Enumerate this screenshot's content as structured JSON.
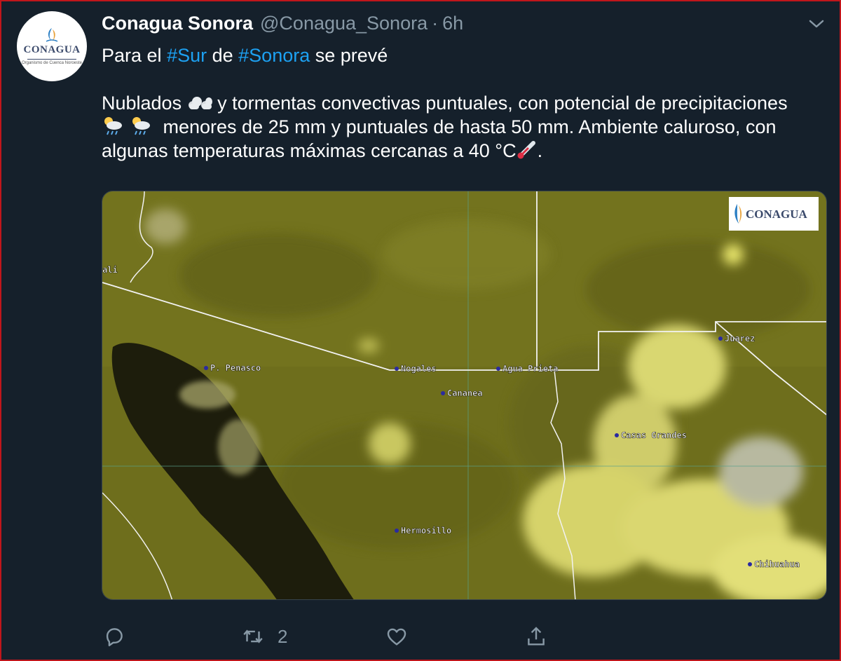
{
  "tweet": {
    "avatar": {
      "icon": "conagua-logo-icon",
      "wordmark": "CONAGUA",
      "tagline": "Organismo de Cuenca Noroeste"
    },
    "author_name": "Conagua Sonora",
    "author_handle": "@Conagua_Sonora",
    "separator": "·",
    "timestamp": "6h",
    "menu_icon": "chevron-down-icon",
    "text": {
      "line1_pre": "Para el ",
      "hashtag1": "#Sur",
      "line1_mid": " de ",
      "hashtag2": "#Sonora",
      "line1_post": " se prevé",
      "p2_a": "Nublados ",
      "p2_b": " y tormentas convectivas puntuales, con potencial de precipitaciones ",
      "p2_c": " menores de 25 mm y puntuales de hasta 50 mm. Ambiente caluroso, con algunas temperaturas máximas cercanas a 40 °C",
      "p2_d": ".",
      "emoji_cloud": "cloud-emoji",
      "emoji_rain": "sun-behind-rain-cloud-emoji",
      "emoji_thermo": "thermometer-emoji"
    },
    "media": {
      "watermark": "CONAGUA",
      "cities": [
        "ali",
        "P. Penasco",
        "Nogales",
        "Agua Prieta",
        "Cananea",
        "Juarez",
        "Casas Grandes",
        "Hermosillo",
        "Chihuahua"
      ]
    },
    "actions": {
      "reply_icon": "reply-icon",
      "retweet_icon": "retweet-icon",
      "retweet_count": "2",
      "like_icon": "heart-icon",
      "share_icon": "share-icon"
    },
    "colors": {
      "background": "#15202b",
      "accent": "#1da1f2",
      "muted": "#8899a6",
      "border": "#c0161b"
    }
  }
}
